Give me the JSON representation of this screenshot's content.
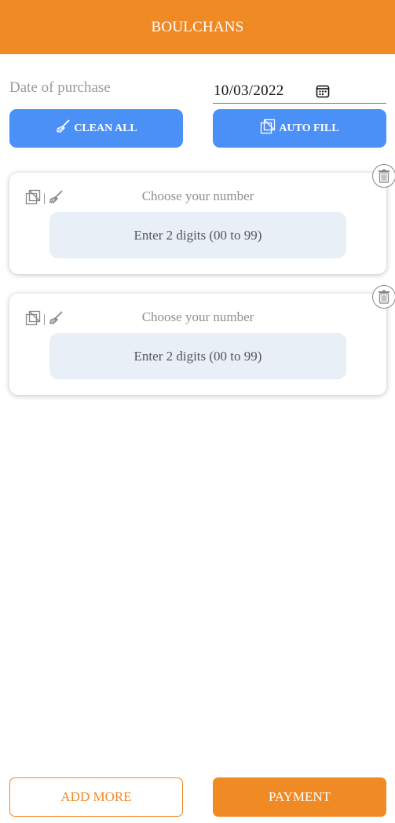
{
  "header": {
    "title": "BOULCHANS"
  },
  "date": {
    "label": "Date of purchase",
    "value": "10/03/2022"
  },
  "actions": {
    "clean_all": "CLEAN ALL",
    "auto_fill": "AUTO FILL"
  },
  "entries": [
    {
      "title": "Choose your number",
      "placeholder": "Enter 2 digits (00 to 99)"
    },
    {
      "title": "Choose your number",
      "placeholder": "Enter 2 digits (00 to 99)"
    }
  ],
  "footer": {
    "add_more": "ADD MORE",
    "payment": "PAYMENT"
  },
  "colors": {
    "brand_orange": "#f08a24",
    "action_blue": "#4a90f7",
    "input_bg": "#e8eff7"
  },
  "icons": {
    "clean": "broom-icon",
    "auto_fill": "copy-icon",
    "calendar": "calendar-icon",
    "delete": "trash-icon"
  }
}
